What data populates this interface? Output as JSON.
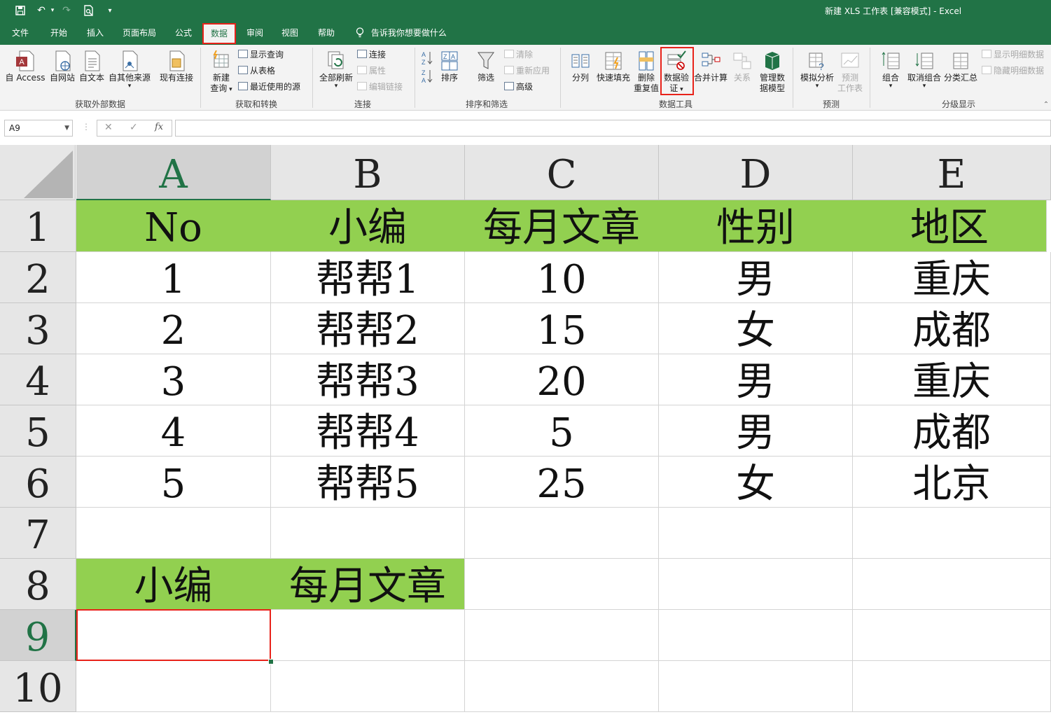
{
  "window": {
    "title": "新建 XLS 工作表 [兼容模式] - Excel"
  },
  "quick_access": {
    "save_icon": "save-icon",
    "undo_icon": "undo-icon",
    "redo_icon": "redo-icon",
    "preview_icon": "print-preview-icon",
    "customize_icon": "customize-icon"
  },
  "menu": {
    "items": [
      "文件",
      "开始",
      "插入",
      "页面布局",
      "公式",
      "数据",
      "审阅",
      "视图",
      "帮助"
    ],
    "active": "数据",
    "tell_me": "告诉我你想要做什么"
  },
  "ribbon": {
    "get_external": {
      "from_access": "自 Access",
      "from_web": "自网站",
      "from_text": "自文本",
      "from_other": "自其他来源",
      "existing": "现有连接",
      "group_label": "获取外部数据"
    },
    "get_transform": {
      "new_query_1": "新建",
      "new_query_2": "查询",
      "show_queries": "显示查询",
      "from_table": "从表格",
      "recent_sources": "最近使用的源",
      "group_label": "获取和转换"
    },
    "connections": {
      "refresh_all": "全部刷新",
      "connections": "连接",
      "properties": "属性",
      "edit_links": "编辑链接",
      "group_label": "连接"
    },
    "sort_filter": {
      "sort": "排序",
      "filter": "筛选",
      "clear": "清除",
      "reapply": "重新应用",
      "advanced": "高级",
      "group_label": "排序和筛选"
    },
    "data_tools": {
      "text_to_columns": "分列",
      "flash_fill": "快速填充",
      "remove_dup_1": "删除",
      "remove_dup_2": "重复值",
      "validation_1": "数据验",
      "validation_2": "证",
      "consolidate": "合并计算",
      "relationships": "关系",
      "manage_model_1": "管理数",
      "manage_model_2": "据模型",
      "group_label": "数据工具"
    },
    "forecast": {
      "what_if": "模拟分析",
      "forecast_sheet_1": "预测",
      "forecast_sheet_2": "工作表",
      "group_label": "预测"
    },
    "outline": {
      "group": "组合",
      "ungroup": "取消组合",
      "subtotal": "分类汇总",
      "show_detail": "显示明细数据",
      "hide_detail": "隐藏明细数据",
      "group_label": "分级显示"
    }
  },
  "formula_bar": {
    "name_box": "A9",
    "cancel": "✕",
    "enter": "✓",
    "fx": "fx",
    "value": ""
  },
  "sheet": {
    "columns": [
      "A",
      "B",
      "C",
      "D",
      "E"
    ],
    "rows": [
      "1",
      "2",
      "3",
      "4",
      "5",
      "6",
      "7",
      "8",
      "9",
      "10"
    ],
    "selected_cell": "A9",
    "header_fill": "#92d050",
    "cells": {
      "A1": "No",
      "B1": "小编",
      "C1": "每月文章",
      "D1": "性别",
      "E1": "地区",
      "A2": "1",
      "B2": "帮帮1",
      "C2": "10",
      "D2": "男",
      "E2": "重庆",
      "A3": "2",
      "B3": "帮帮2",
      "C3": "15",
      "D3": "女",
      "E3": "成都",
      "A4": "3",
      "B4": "帮帮3",
      "C4": "20",
      "D4": "男",
      "E4": "重庆",
      "A5": "4",
      "B5": "帮帮4",
      "C5": "5",
      "D5": "男",
      "E5": "成都",
      "A6": "5",
      "B6": "帮帮5",
      "C6": "25",
      "D6": "女",
      "E6": "北京",
      "A8": "小编",
      "B8": "每月文章"
    }
  },
  "colors": {
    "brand": "#217346",
    "highlight": "#e8221a"
  }
}
